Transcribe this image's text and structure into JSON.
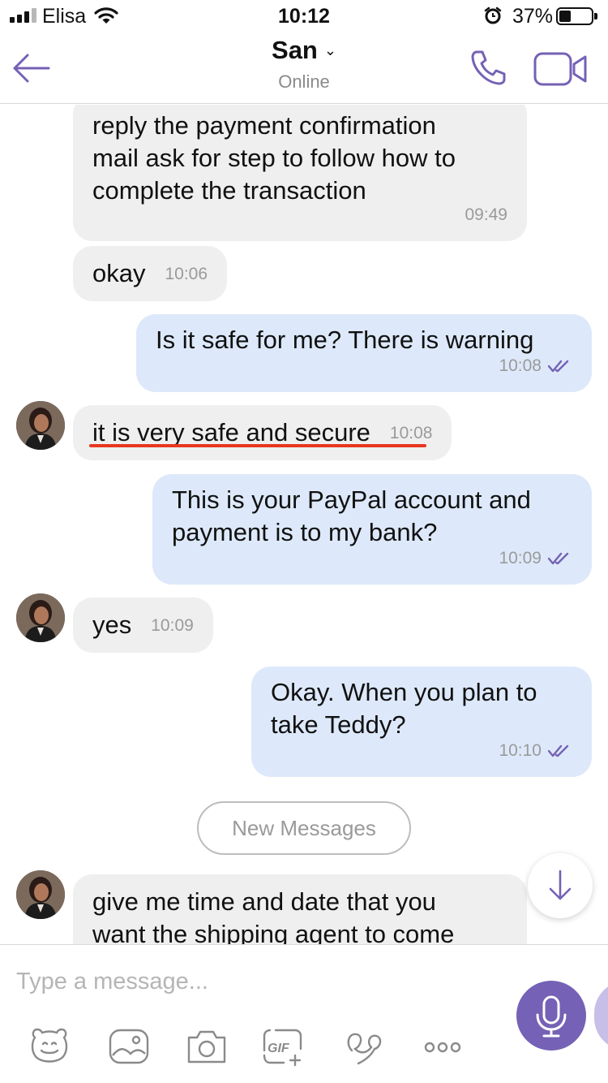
{
  "status_bar": {
    "carrier": "Elisa",
    "time": "10:12",
    "battery_percent": "37%",
    "battery_level": 0.37,
    "signal_bars": 3
  },
  "header": {
    "contact_name": "San",
    "contact_status": "Online",
    "accent_color": "#7561b5"
  },
  "messages": [
    {
      "direction": "in",
      "text": "reply the payment confirmation\nmail ask for step to follow how to\ncomplete the transaction",
      "time": "09:49"
    },
    {
      "direction": "in",
      "text": "okay",
      "time": "10:06"
    },
    {
      "direction": "out",
      "text": "Is it safe for me? There is warning",
      "time": "10:08",
      "status": "read"
    },
    {
      "direction": "in",
      "text": "it is very safe and secure",
      "time": "10:08",
      "underlined": true
    },
    {
      "direction": "out",
      "text": "This is your PayPal account and\npayment is to my bank?",
      "time": "10:09",
      "status": "read"
    },
    {
      "direction": "in",
      "text": "yes",
      "time": "10:09"
    },
    {
      "direction": "out",
      "text": "Okay. When you plan to\ntake Teddy?",
      "time": "10:10",
      "status": "read"
    },
    {
      "direction": "in",
      "text": "give me time and date that you\nwant the shipping agent to come",
      "time": ""
    }
  ],
  "new_messages_label": "New Messages",
  "composer": {
    "placeholder": "Type a message...",
    "gif_label": "GIF",
    "toolbar": [
      "sticker-icon",
      "gallery-icon",
      "camera-icon",
      "gif-icon",
      "doodle-icon",
      "more-icon"
    ]
  }
}
